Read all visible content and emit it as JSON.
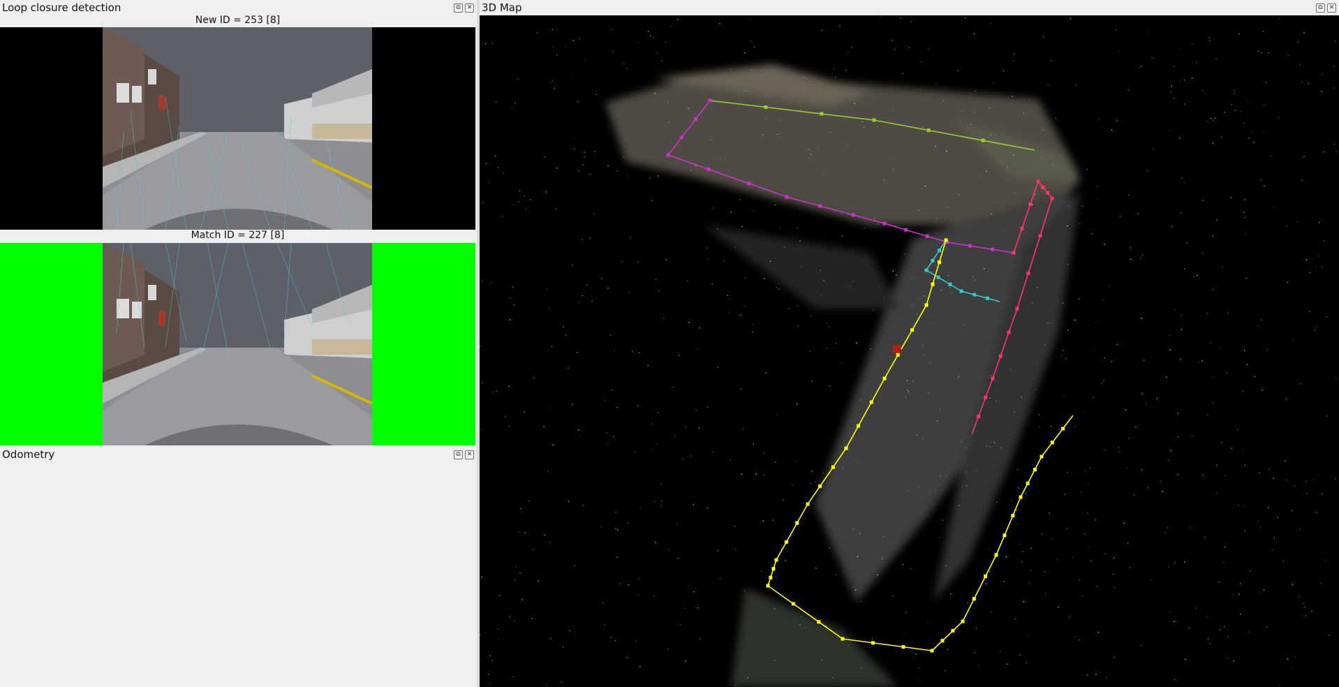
{
  "loop_closure": {
    "title": "Loop closure detection",
    "new_label": "New ID = 253 [8]",
    "match_label": "Match ID = 227 [8]",
    "match_border_color": "#00ff00"
  },
  "odometry": {
    "title": "Odometry"
  },
  "map3d": {
    "title": "3D Map",
    "trajectory_colors": {
      "loop": "#ffff00",
      "top": "#9acd32",
      "left": "#cc33cc",
      "right": "#ff3366",
      "cross": "#33cccc"
    }
  },
  "dock_buttons": {
    "float_icon": "float-icon",
    "close_icon": "close-icon"
  }
}
